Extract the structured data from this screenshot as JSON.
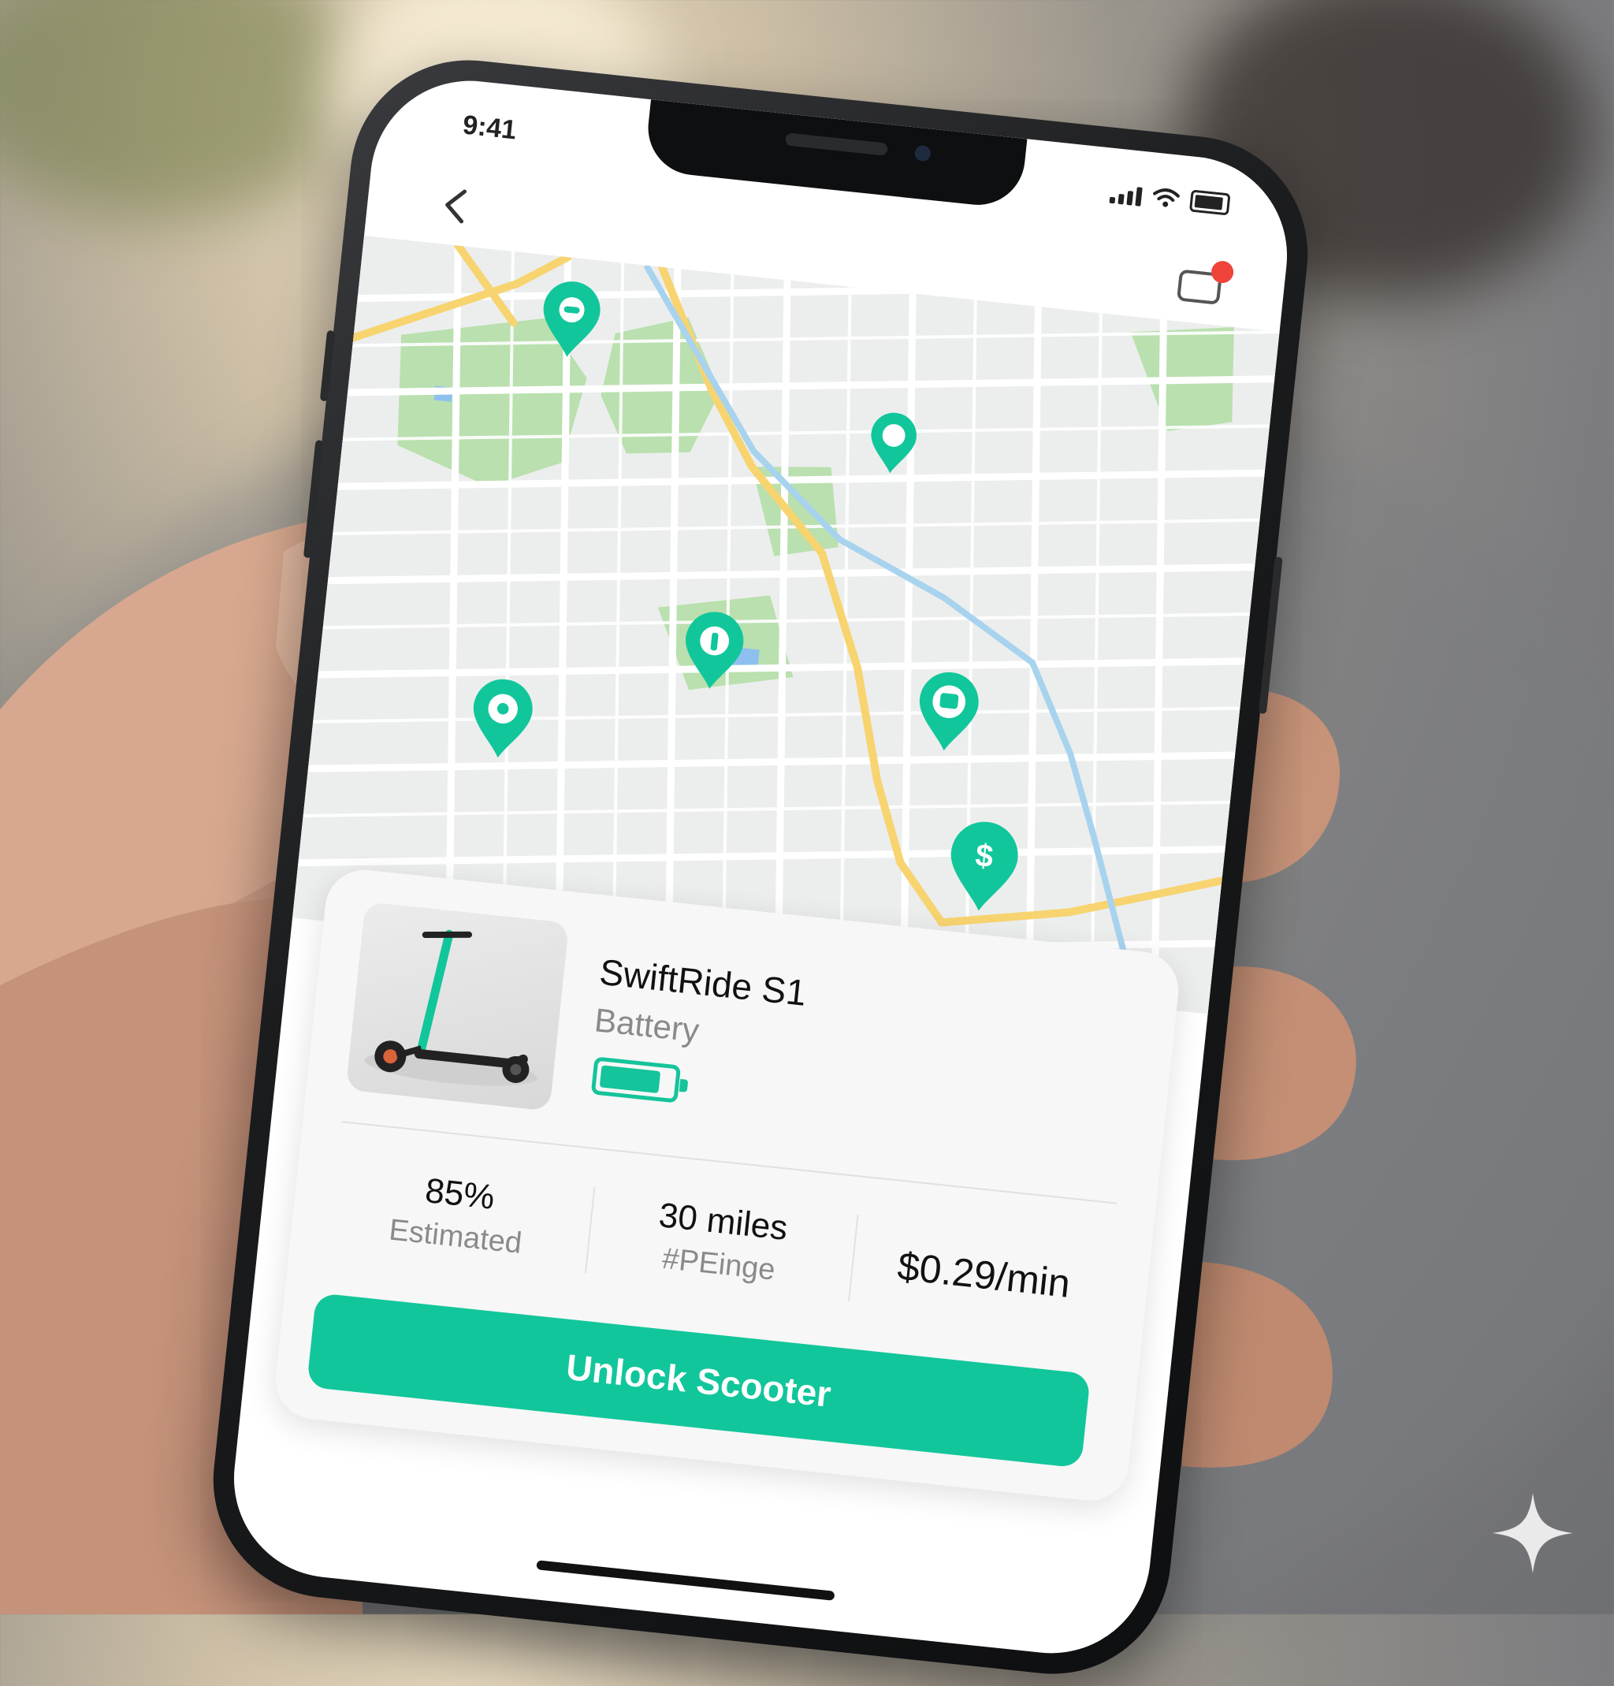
{
  "status_bar": {
    "time": "9:41"
  },
  "nav": {
    "back_icon": "chevron-left-icon",
    "action_icon": "message-icon"
  },
  "map": {
    "pins": [
      {
        "icon": "scooter-icon"
      },
      {
        "icon": "location-icon"
      },
      {
        "icon": "info-icon"
      },
      {
        "icon": "location-icon"
      },
      {
        "icon": "bus-icon"
      },
      {
        "label": "$"
      }
    ]
  },
  "scooter": {
    "name": "SwiftRide S1",
    "battery_label": "Battery",
    "battery_level": 0.85
  },
  "stats": [
    {
      "value": "85%",
      "label": "Estimated"
    },
    {
      "value": "30 miles",
      "label": "#PEinge"
    },
    {
      "value": "$0.29/min",
      "label": ""
    }
  ],
  "actions": {
    "unlock_label": "Unlock Scooter"
  },
  "colors": {
    "accent": "#12c69b",
    "notification": "#f0433a"
  }
}
